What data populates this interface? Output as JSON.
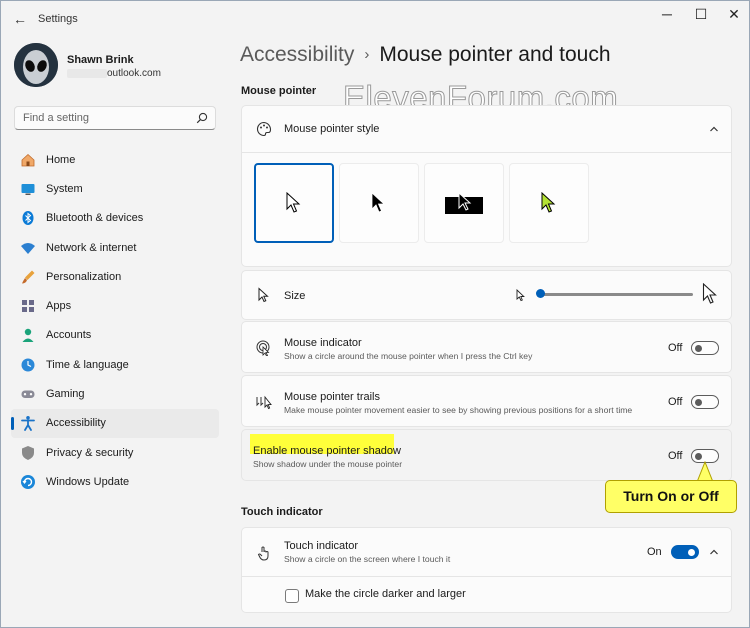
{
  "window": {
    "title": "Settings",
    "back_glyph": "←",
    "controls": {
      "minimize": "─",
      "maximize": "☐",
      "close": "✕"
    }
  },
  "profile": {
    "name": "Shawn Brink",
    "email_suffix": "outlook.com"
  },
  "search": {
    "placeholder": "Find a setting",
    "icon": "search-icon"
  },
  "sidebar": {
    "items": [
      {
        "label": "Home",
        "icon": "home-icon",
        "active": false
      },
      {
        "label": "System",
        "icon": "system-icon",
        "active": false
      },
      {
        "label": "Bluetooth & devices",
        "icon": "bluetooth-icon",
        "active": false
      },
      {
        "label": "Network & internet",
        "icon": "wifi-icon",
        "active": false
      },
      {
        "label": "Personalization",
        "icon": "brush-icon",
        "active": false
      },
      {
        "label": "Apps",
        "icon": "apps-icon",
        "active": false
      },
      {
        "label": "Accounts",
        "icon": "accounts-icon",
        "active": false
      },
      {
        "label": "Time & language",
        "icon": "globe-clock-icon",
        "active": false
      },
      {
        "label": "Gaming",
        "icon": "gamepad-icon",
        "active": false
      },
      {
        "label": "Accessibility",
        "icon": "accessibility-icon",
        "active": true
      },
      {
        "label": "Privacy & security",
        "icon": "shield-icon",
        "active": false
      },
      {
        "label": "Windows Update",
        "icon": "update-icon",
        "active": false
      }
    ]
  },
  "header": {
    "parent": "Accessibility",
    "separator": "›",
    "current": "Mouse pointer and touch"
  },
  "watermark": "ElevenForum.com",
  "mouse_pointer": {
    "section_title": "Mouse pointer",
    "style": {
      "title": "Mouse pointer style",
      "expanded": true,
      "options": [
        "white",
        "black",
        "inverted",
        "custom"
      ],
      "selected": "white"
    },
    "size": {
      "title": "Size",
      "value_fraction": 0.0
    },
    "indicator": {
      "title": "Mouse indicator",
      "description": "Show a circle around the mouse pointer when I press the Ctrl key",
      "state": "Off"
    },
    "trails": {
      "title": "Mouse pointer trails",
      "description": "Make mouse pointer movement easier to see by showing previous positions for a short time",
      "state": "Off"
    },
    "shadow": {
      "title": "Enable mouse pointer shadow",
      "description": "Show shadow under the mouse pointer",
      "state": "Off"
    }
  },
  "callout": {
    "text": "Turn On or Off"
  },
  "touch": {
    "section_title": "Touch indicator",
    "indicator": {
      "title": "Touch indicator",
      "description": "Show a circle on the screen where I touch it",
      "state": "On"
    },
    "darker": {
      "label": "Make the circle darker and larger",
      "checked": false
    }
  },
  "colors": {
    "accent": "#005fb8",
    "highlight": "#ffff3a",
    "callout": "#ffff66",
    "lime_pointer": "#b4e234"
  }
}
